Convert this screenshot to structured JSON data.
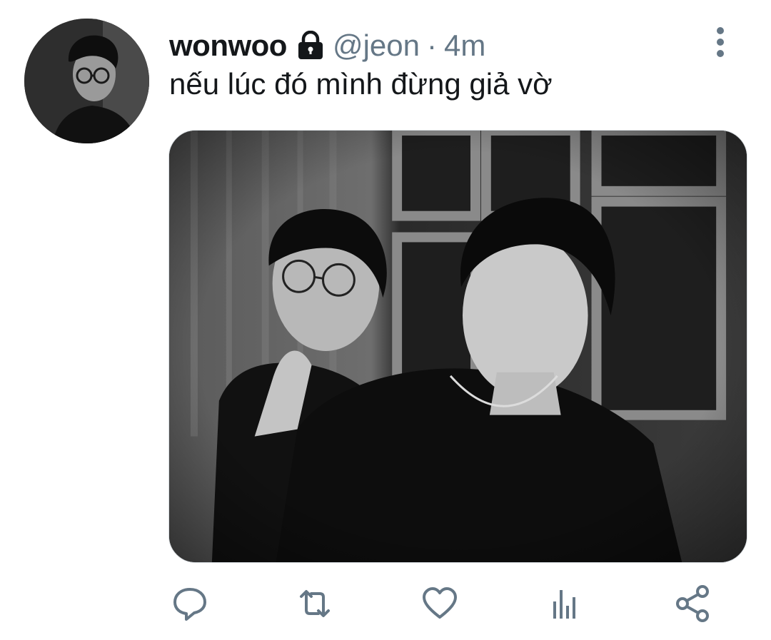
{
  "tweet": {
    "display_name": "wonwoo",
    "handle": "@jeon",
    "separator": "·",
    "time": "4m",
    "text": "nếu lúc đó mình đừng giả vờ",
    "protected_icon": "lock-icon",
    "more_icon": "more-vertical-icon"
  },
  "actions": [
    {
      "name": "reply",
      "icon": "reply-icon"
    },
    {
      "name": "retweet",
      "icon": "retweet-icon"
    },
    {
      "name": "like",
      "icon": "heart-icon"
    },
    {
      "name": "analytics",
      "icon": "analytics-icon"
    },
    {
      "name": "share",
      "icon": "share-icon"
    }
  ],
  "colors": {
    "text_primary": "#14171a",
    "text_secondary": "#657786",
    "icon": "#657786",
    "background": "#ffffff"
  }
}
